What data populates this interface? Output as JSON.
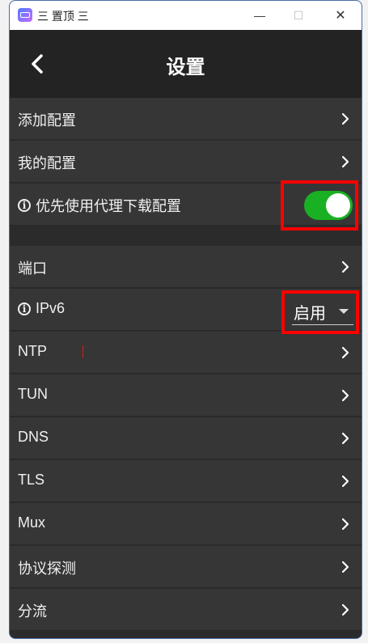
{
  "window": {
    "title": "三 置顶 三",
    "minimize_label": "—",
    "maximize_label": "☐",
    "close_label": "✕"
  },
  "header": {
    "title": "设置"
  },
  "section1": [
    {
      "label": "添加配置",
      "has_chevron": true
    },
    {
      "label": "我的配置",
      "has_chevron": true
    },
    {
      "label": "优先使用代理下载配置",
      "has_info_icon": true,
      "toggle_on": true
    }
  ],
  "section2": [
    {
      "label": "端口"
    },
    {
      "label": "IPv6",
      "has_info_icon": true,
      "select_value": "启用"
    },
    {
      "label": "NTP"
    },
    {
      "label": "TUN"
    },
    {
      "label": "DNS"
    },
    {
      "label": "TLS"
    },
    {
      "label": "Mux"
    },
    {
      "label": "协议探测"
    },
    {
      "label": "分流"
    }
  ],
  "info_icon_glyph": "i",
  "colors": {
    "toggle_on": "#19b023",
    "highlight": "#ff0000",
    "row_bg": "#363636",
    "header_bg": "#232323"
  }
}
